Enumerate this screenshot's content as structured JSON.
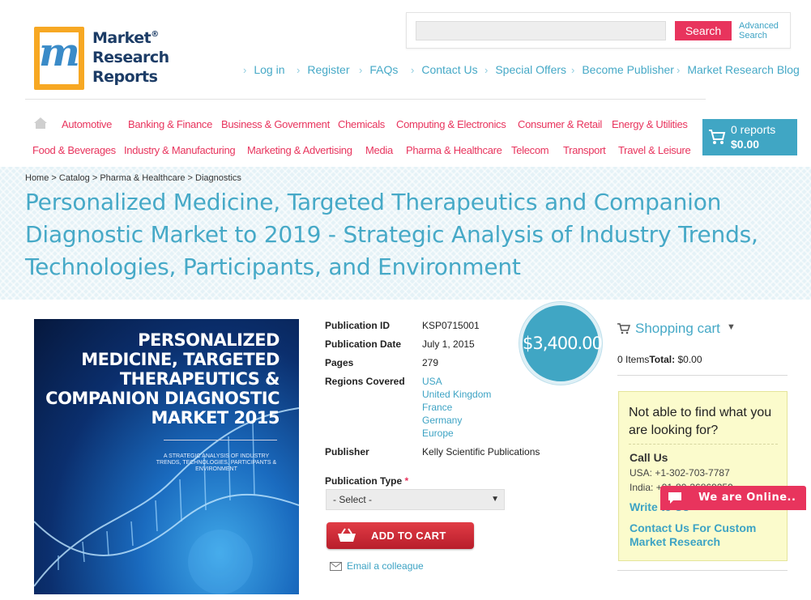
{
  "brand": {
    "logo_letter": "m",
    "line1": "Market",
    "registered": "®",
    "line2": "Research",
    "line3": "Reports",
    "accent_color": "#e8345d",
    "link_color": "#46a9c7"
  },
  "search": {
    "placeholder": "",
    "button_label": "Search",
    "advanced_line1": "Advanced",
    "advanced_line2": "Search"
  },
  "top_links": [
    "Log in",
    "Register",
    "FAQs",
    "Contact Us",
    "Special Offers",
    "Become Publisher",
    "Market Research Blog"
  ],
  "categories_row1": [
    "Automotive",
    "Banking & Finance",
    "Business & Government",
    "Chemicals",
    "Computing & Electronics",
    "Consumer & Retail",
    "Energy & Utilities"
  ],
  "categories_row2": [
    "Food & Beverages",
    "Industry & Manufacturing",
    "Marketing & Advertising",
    "Media",
    "Pharma & Healthcare",
    "Telecom",
    "Transport",
    "Travel & Leisure"
  ],
  "cart_widget": {
    "count_label": "0 reports",
    "total": "$0.00",
    "icon": "cart-icon"
  },
  "breadcrumb": "Home > Catalog > Pharma & Healthcare > Diagnostics",
  "title": "Personalized Medicine, Targeted Therapeutics and Companion Diagnostic Market to 2019 - Strategic Analysis of Industry Trends, Technologies, Participants, and Environment",
  "cover": {
    "title_lines": [
      "PERSONALIZED",
      "MEDICINE, TARGETED",
      "THERAPEUTICS &",
      "COMPANION DIAGNOSTIC",
      "MARKET 2015"
    ],
    "subtitle": "A STRATEGIC ANALYSIS OF INDUSTRY TRENDS, TECHNOLOGIES, PARTICIPANTS & ENVIRONMENT"
  },
  "specs": {
    "publication_id": {
      "label": "Publication ID",
      "value": "KSP0715001"
    },
    "publication_date": {
      "label": "Publication Date",
      "value": "July 1, 2015"
    },
    "pages": {
      "label": "Pages",
      "value": "279"
    },
    "regions": {
      "label": "Regions Covered",
      "values": [
        "USA",
        "United Kingdom",
        "France",
        "Germany",
        "Europe"
      ]
    },
    "publisher": {
      "label": "Publisher",
      "value": "Kelly Scientific Publications"
    }
  },
  "price": "$3,400.00",
  "publication_type": {
    "label": "Publication Type",
    "required_mark": "*",
    "selected": "- Select -"
  },
  "add_to_cart_label": "ADD TO CART",
  "email_colleague_label": "Email a colleague",
  "sidebar": {
    "cart_title": "Shopping cart",
    "cart_items": "0 Items",
    "cart_total_label": "Total:",
    "cart_total_value": "$0.00",
    "help_question": "Not able to find what you are looking for?",
    "call_us": "Call Us",
    "phone_usa": "USA: +1-302-703-7787",
    "phone_india": "India: +91-80-36869259",
    "write_to_us": "Write to Us",
    "contact_custom": "Contact Us For Custom Market Research"
  },
  "chat": {
    "label": "We are Online.."
  }
}
